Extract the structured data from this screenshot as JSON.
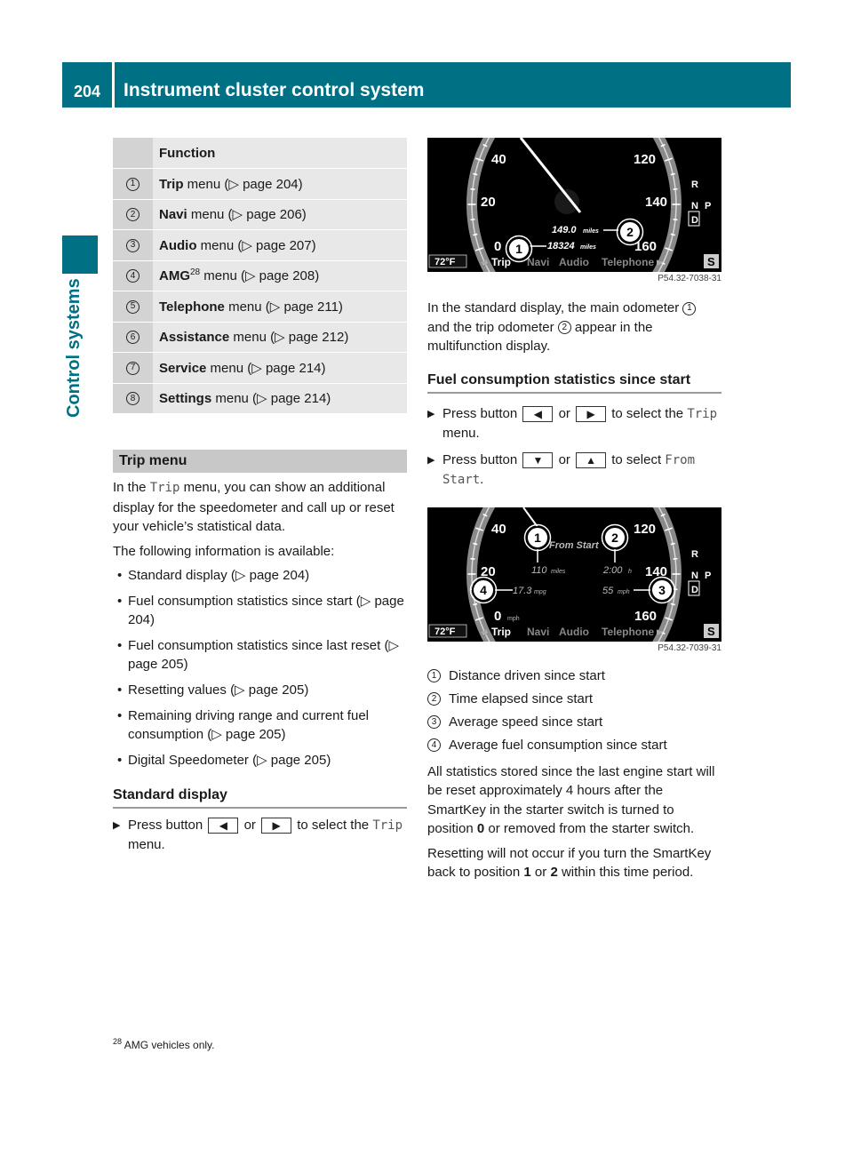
{
  "header": {
    "page_number": "204",
    "title": "Instrument cluster control system"
  },
  "side_tab": {
    "label": "Control systems",
    "accent": "#007185"
  },
  "function_table": {
    "header": "Function",
    "rows": [
      {
        "num": "1",
        "bold": "Trip",
        "sup": "",
        "rest": " menu (▷ page 204)"
      },
      {
        "num": "2",
        "bold": "Navi",
        "sup": "",
        "rest": " menu (▷ page 206)"
      },
      {
        "num": "3",
        "bold": "Audio",
        "sup": "",
        "rest": " menu (▷ page 207)"
      },
      {
        "num": "4",
        "bold": "AMG",
        "sup": "28",
        "rest": " menu (▷ page 208)"
      },
      {
        "num": "5",
        "bold": "Telephone",
        "sup": "",
        "rest": " menu (▷ page 211)"
      },
      {
        "num": "6",
        "bold": "Assistance",
        "sup": "",
        "rest": " menu (▷ page 212)"
      },
      {
        "num": "7",
        "bold": "Service",
        "sup": "",
        "rest": " menu (▷ page 214)"
      },
      {
        "num": "8",
        "bold": "Settings",
        "sup": "",
        "rest": " menu (▷ page 214)"
      }
    ]
  },
  "trip_menu": {
    "title": "Trip menu",
    "intro_pre": "In the ",
    "intro_mono": "Trip",
    "intro_post": " menu, you can show an additional display for the speedometer and call up or reset your vehicle’s statistical data.",
    "available": "The following information is available:",
    "items": [
      "Standard display (▷ page 204)",
      "Fuel consumption statistics since start (▷ page 204)",
      "Fuel consumption statistics since last reset (▷ page 205)",
      "Resetting values (▷ page 205)",
      "Remaining driving range and current fuel consumption (▷ page 205)",
      "Digital Speedometer (▷ page 205)"
    ]
  },
  "standard_display": {
    "title": "Standard display",
    "step1": {
      "pre": "Press button",
      "key1": "◀",
      "or": "or",
      "key2": "▶",
      "post": "to select the",
      "mono": "Trip",
      "end": " menu."
    }
  },
  "figure1": {
    "code": "P54.32-7038-31",
    "left_ticks": [
      "40",
      "20",
      "0"
    ],
    "right_ticks": [
      "120",
      "140",
      "160"
    ],
    "gear": [
      "R",
      "N",
      "D",
      "P"
    ],
    "temp": "72°F",
    "menu": [
      "Trip",
      "Navi",
      "Audio",
      "Telephone"
    ],
    "s_badge": "S",
    "trip_odometer": "149.0",
    "trip_unit": "miles",
    "main_odometer": "18324",
    "main_unit": "miles",
    "callouts": [
      "1",
      "2"
    ]
  },
  "std_desc": {
    "pre": "In the standard display, the main odometer ",
    "c1": "1",
    "mid": " and the trip odometer ",
    "c2": "2",
    "post": " appear in the multifunction display."
  },
  "fuel_since_start": {
    "title": "Fuel consumption statistics since start",
    "step1": {
      "pre": "Press button",
      "key1": "◀",
      "or": "or",
      "key2": "▶",
      "post": "to select the",
      "mono": "Trip",
      "end": " menu."
    },
    "step2": {
      "pre": "Press button",
      "key1": "▼",
      "or": "or",
      "key2": "▲",
      "post": "to select",
      "mono": "From Start",
      "end": "."
    }
  },
  "figure2": {
    "code": "P54.32-7039-31",
    "left_ticks": [
      "40",
      "20",
      "0"
    ],
    "left_zero_unit": "mph",
    "right_ticks": [
      "120",
      "140",
      "160"
    ],
    "gear": [
      "R",
      "N",
      "D",
      "P"
    ],
    "temp": "72°F",
    "menu": [
      "Trip",
      "Navi",
      "Audio",
      "Telephone"
    ],
    "s_badge": "S",
    "heading": "From Start",
    "distance": "110",
    "distance_unit": "miles",
    "time": "2:00",
    "time_unit": "h",
    "fuel": "17.3",
    "fuel_unit": "mpg",
    "speed": "55",
    "speed_unit": "mph",
    "callouts": [
      "1",
      "2",
      "3",
      "4"
    ]
  },
  "legend": [
    {
      "num": "1",
      "text": "Distance driven since start"
    },
    {
      "num": "2",
      "text": "Time elapsed since start"
    },
    {
      "num": "3",
      "text": "Average speed since start"
    },
    {
      "num": "4",
      "text": "Average fuel consumption since start"
    }
  ],
  "reset_note": {
    "p1_pre": "All statistics stored since the last engine start will be reset approximately 4 hours after the SmartKey in the starter switch is turned to position ",
    "p1_bold": "0",
    "p1_post": " or removed from the starter switch.",
    "p2_pre": "Resetting will not occur if you turn the SmartKey back to position ",
    "p2_b1": "1",
    "p2_mid": " or ",
    "p2_b2": "2",
    "p2_post": " within this time period."
  },
  "footnote": {
    "num": "28",
    "text": " AMG vehicles only."
  }
}
